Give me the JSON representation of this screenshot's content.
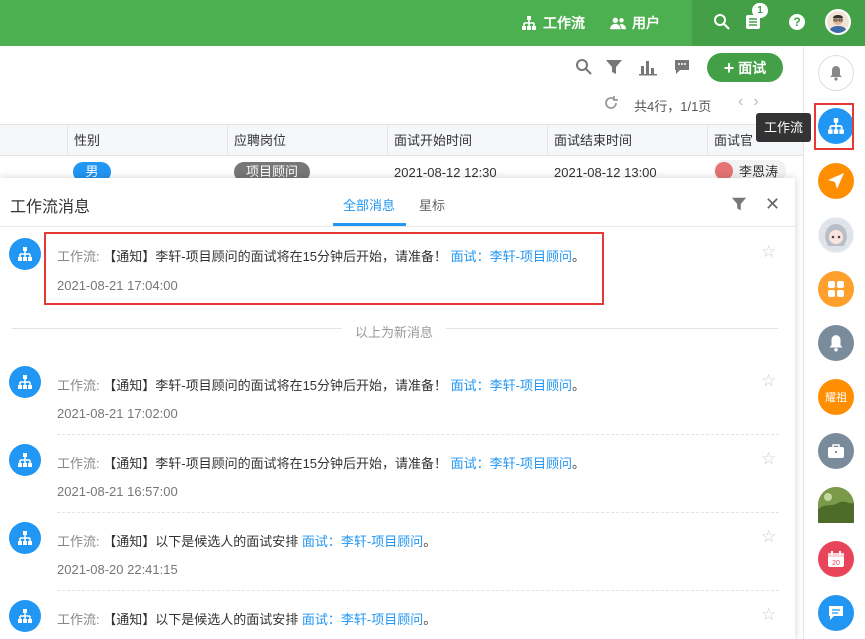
{
  "topbar": {
    "workflow_label": "工作流",
    "users_label": "用户",
    "notification_count": "1",
    "colors": {
      "primary": "#4caf50",
      "primary_dark": "#43a047"
    }
  },
  "toolbar": {
    "add_interview_label": "面试",
    "pager_text": "共4行，1/1页"
  },
  "table": {
    "headers": [
      "性别",
      "应聘岗位",
      "面试开始时间",
      "面试结束时间",
      "面试官"
    ],
    "row": {
      "gender": "男",
      "position": "项目顾问",
      "start": "2021-08-12 12:30",
      "end": "2021-08-12 13:00",
      "interviewer": "李恩涛"
    }
  },
  "sidebar": {
    "tooltip": "工作流",
    "item_group_label": "耀祖",
    "calendar_day": "20"
  },
  "panel": {
    "title": "工作流消息",
    "tab_all": "全部消息",
    "tab_star": "星标",
    "new_divider": "以上为新消息",
    "messages": [
      {
        "prefix": "工作流:",
        "body": "【通知】李轩-项目顾问的面试将在15分钟后开始，请准备！",
        "link": "面试：李轩-项目顾问",
        "suffix": "。",
        "time": "2021-08-21 17:04:00"
      },
      {
        "prefix": "工作流:",
        "body": "【通知】李轩-项目顾问的面试将在15分钟后开始，请准备！",
        "link": "面试：李轩-项目顾问",
        "suffix": "。",
        "time": "2021-08-21 17:02:00"
      },
      {
        "prefix": "工作流:",
        "body": "【通知】李轩-项目顾问的面试将在15分钟后开始，请准备！",
        "link": "面试：李轩-项目顾问",
        "suffix": "。",
        "time": "2021-08-21 16:57:00"
      },
      {
        "prefix": "工作流:",
        "body": "【通知】以下是候选人的面试安排",
        "link": "面试：李轩-项目顾问",
        "suffix": "。",
        "time": "2021-08-20 22:41:15"
      },
      {
        "prefix": "工作流:",
        "body": "【通知】以下是候选人的面试安排",
        "link": "面试：李轩-项目顾问",
        "suffix": "。",
        "time": ""
      }
    ]
  }
}
